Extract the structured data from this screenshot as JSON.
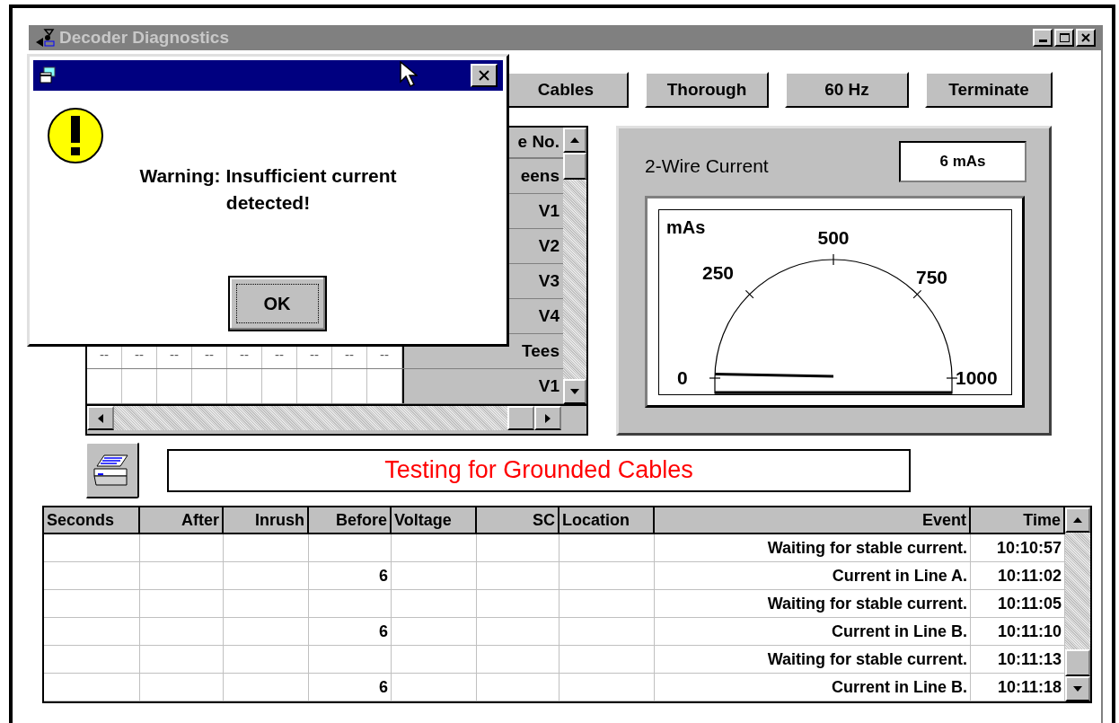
{
  "window": {
    "title": "Decoder Diagnostics"
  },
  "toolbar": {
    "buttons": [
      "Cables",
      "Thorough",
      "60 Hz",
      "Terminate"
    ]
  },
  "grid": {
    "header": "e No.",
    "labels": [
      "eens",
      "V1",
      "V2",
      "V3",
      "V4",
      "Tees",
      "V1"
    ],
    "dashes": [
      "--",
      "--",
      "--",
      "--",
      "--",
      "--",
      "--",
      "--",
      "--"
    ]
  },
  "meter": {
    "title": "2-Wire Current",
    "reading": "6 mAs",
    "unit": "mAs",
    "ticks": [
      "0",
      "250",
      "500",
      "750",
      "1000"
    ]
  },
  "status_message": "Testing for Grounded Cables",
  "log": {
    "columns": [
      "Seconds",
      "After",
      "Inrush",
      "Before",
      "Voltage",
      "SC",
      "Location",
      "Event",
      "Time"
    ],
    "rows": [
      {
        "event": "Waiting for stable current.",
        "time": "10:10:57"
      },
      {
        "before": "6",
        "event": "Current in Line A.",
        "time": "10:11:02"
      },
      {
        "event": "Waiting for stable current.",
        "time": "10:11:05"
      },
      {
        "before": "6",
        "event": "Current in Line B.",
        "time": "10:11:10"
      },
      {
        "event": "Waiting for stable current.",
        "time": "10:11:13"
      },
      {
        "before": "6",
        "event": "Current in Line B.",
        "time": "10:11:18"
      }
    ]
  },
  "dialog": {
    "message": "Warning: Insufficient current detected!",
    "button": "OK"
  }
}
